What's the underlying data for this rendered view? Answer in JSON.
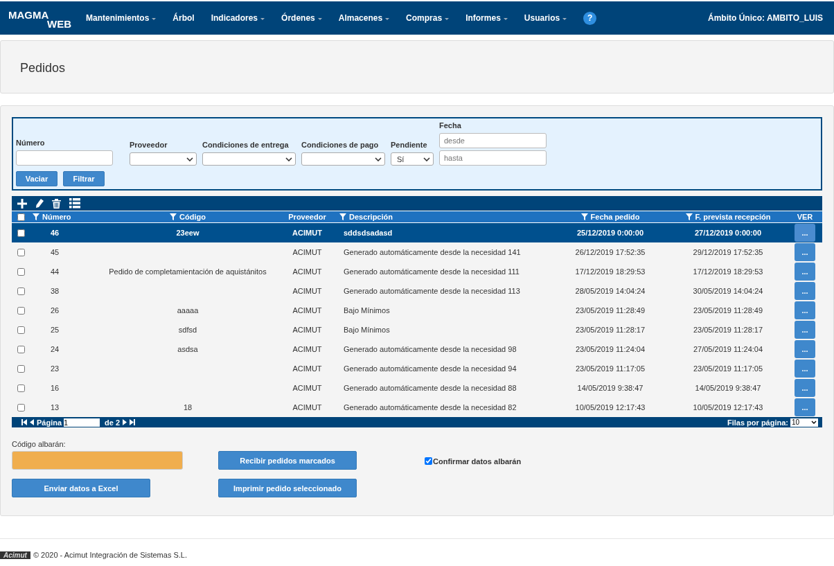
{
  "navbar": {
    "logo_top": "MAGMA",
    "logo_bottom": "WEB",
    "menu": [
      {
        "label": "Mantenimientos",
        "dropdown": true
      },
      {
        "label": "Árbol",
        "dropdown": false
      },
      {
        "label": "Indicadores",
        "dropdown": true
      },
      {
        "label": "Órdenes",
        "dropdown": true
      },
      {
        "label": "Almacenes",
        "dropdown": true
      },
      {
        "label": "Compras",
        "dropdown": true
      },
      {
        "label": "Informes",
        "dropdown": true
      },
      {
        "label": "Usuarios",
        "dropdown": true
      }
    ],
    "help": "?",
    "scope": "Ámbito Único: AMBITO_LUIS"
  },
  "page_title": "Pedidos",
  "filters": {
    "numero": {
      "label": "Número"
    },
    "proveedor": {
      "label": "Proveedor"
    },
    "entrega": {
      "label": "Condiciones de entrega"
    },
    "pago": {
      "label": "Condiciones de pago"
    },
    "pendiente": {
      "label": "Pendiente",
      "value": "Sí"
    },
    "fecha": {
      "label": "Fecha",
      "from_placeholder": "desde",
      "to_placeholder": "hasta"
    },
    "buttons": [
      "Vaciar",
      "Filtrar"
    ]
  },
  "table": {
    "columns": [
      {
        "label": "Número",
        "filter": true
      },
      {
        "label": "Código",
        "filter": true
      },
      {
        "label": "Proveedor",
        "filter": false
      },
      {
        "label": "Descripción",
        "filter": true
      },
      {
        "label": "Fecha pedido",
        "filter": true
      },
      {
        "label": "F. prevista recepción",
        "filter": true
      },
      {
        "label": "VER",
        "filter": false
      }
    ],
    "header_checked": false,
    "rows": [
      {
        "selected": true,
        "checked": false,
        "cells": [
          "46",
          "23eew",
          "ACIMUT",
          "sddsdsadasd",
          "25/12/2019 0:00:00",
          "27/12/2019 0:00:00"
        ],
        "action": "..."
      },
      {
        "selected": false,
        "checked": false,
        "cells": [
          "45",
          "",
          "ACIMUT",
          "Generado automáticamente desde la necesidad 141",
          "26/12/2019 17:52:35",
          "29/12/2019 17:52:35"
        ],
        "action": "..."
      },
      {
        "selected": false,
        "checked": false,
        "cells": [
          "44",
          "Pedido de completamientación de aquistánitos",
          "ACIMUT",
          "Generado automáticamente desde la necesidad 111",
          "17/12/2019 18:29:53",
          "17/12/2019 18:29:53"
        ],
        "action": "..."
      },
      {
        "selected": false,
        "checked": false,
        "cells": [
          "38",
          "",
          "ACIMUT",
          "Generado automáticamente desde la necesidad 113",
          "28/05/2019 14:04:24",
          "30/05/2019 14:04:24"
        ],
        "action": "..."
      },
      {
        "selected": false,
        "checked": false,
        "cells": [
          "26",
          "aaaaa",
          "ACIMUT",
          "Bajo Mínimos",
          "23/05/2019 11:28:49",
          "23/05/2019 11:28:49"
        ],
        "action": "..."
      },
      {
        "selected": false,
        "checked": false,
        "cells": [
          "25",
          "sdfsd",
          "ACIMUT",
          "Bajo Mínimos",
          "23/05/2019 11:28:17",
          "23/05/2019 11:28:17"
        ],
        "action": "..."
      },
      {
        "selected": false,
        "checked": false,
        "cells": [
          "24",
          "asdsa",
          "ACIMUT",
          "Generado automáticamente desde la necesidad 98",
          "23/05/2019 11:24:04",
          "27/05/2019 11:24:04"
        ],
        "action": "..."
      },
      {
        "selected": false,
        "checked": false,
        "cells": [
          "23",
          "",
          "ACIMUT",
          "Generado automáticamente desde la necesidad 94",
          "23/05/2019 11:17:05",
          "23/05/2019 11:17:05"
        ],
        "action": "..."
      },
      {
        "selected": false,
        "checked": false,
        "cells": [
          "16",
          "",
          "ACIMUT",
          "Generado automáticamente desde la necesidad 88",
          "14/05/2019 9:38:47",
          "14/05/2019 9:38:47"
        ],
        "action": "..."
      },
      {
        "selected": false,
        "checked": false,
        "cells": [
          "13",
          "18",
          "ACIMUT",
          "Generado automáticamente desde la necesidad 82",
          "10/05/2019 12:17:43",
          "10/05/2019 12:17:43"
        ],
        "action": "..."
      }
    ],
    "pager": {
      "page_label": "Página",
      "page_value": "1",
      "of_label": "de 2",
      "rows_label": "Filas por página:",
      "rows_value": "10"
    }
  },
  "albaran": {
    "label": "Código albarán:",
    "confirm_label": "Confirmar datos albarán",
    "confirm_checked": true
  },
  "actions": [
    "Recibir pedidos marcados",
    "Enviar datos a Excel",
    "Imprimir pedido seleccionado"
  ],
  "footer": {
    "logo": "Acimut",
    "text": "© 2020 - Acimut Integración de Sistemas S.L."
  }
}
